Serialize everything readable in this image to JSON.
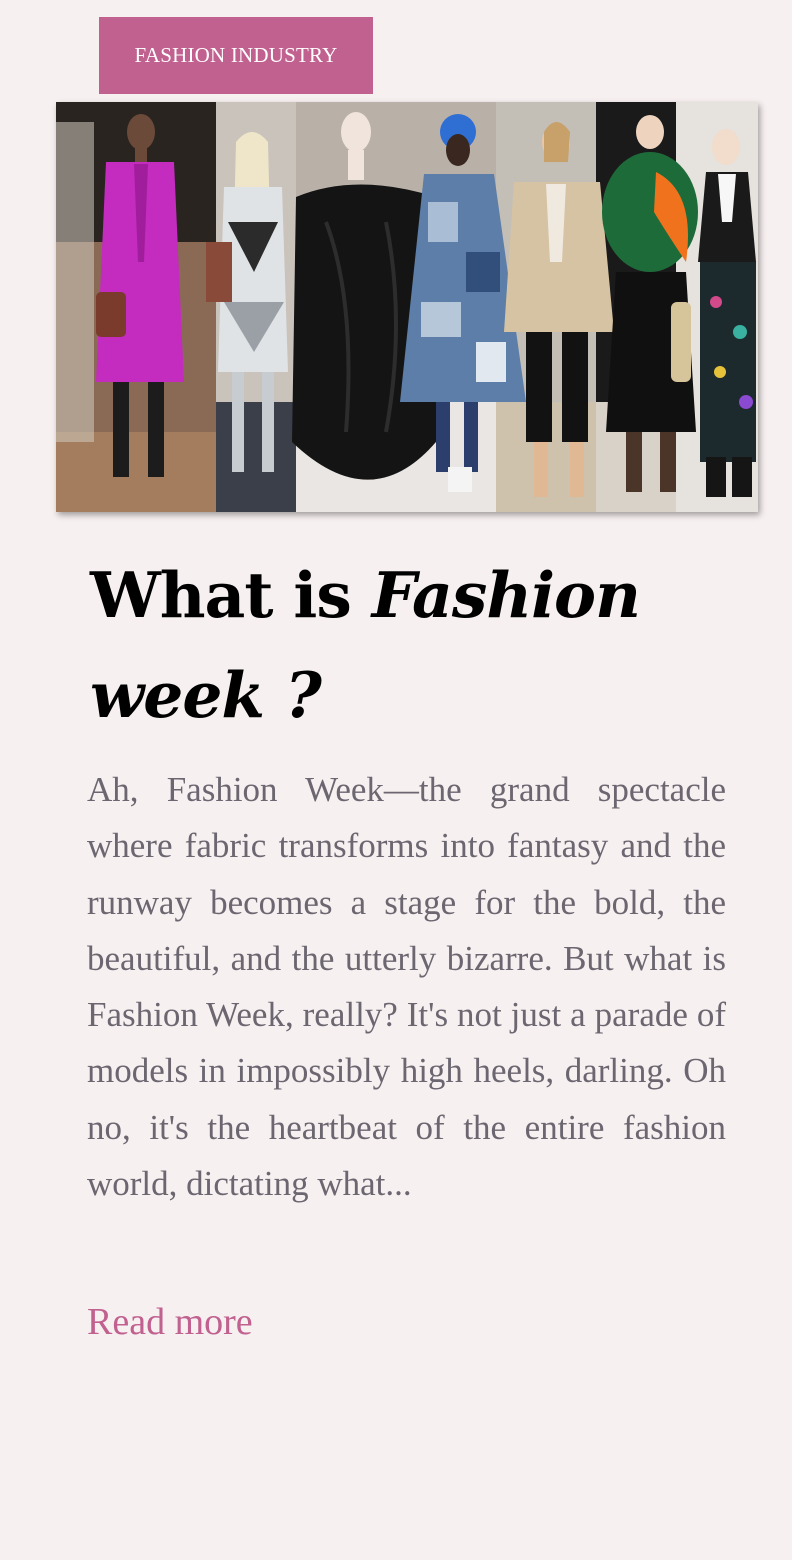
{
  "post": {
    "category": "FASHION INDUSTRY",
    "title_plain": "What is ",
    "title_italic_1": "Fashion",
    "title_italic_2": "week ?",
    "excerpt": "Ah, Fashion Week—the grand spectacle where fabric transforms into fantasy and the runway becomes a stage for the bold, the beautiful, and the utterly bizarre. But what is Fashion Week, really? It's not just a parade of models in impossibly high heels, darling. Oh no, it's the heartbeat of the entire fashion world, dictating what...",
    "read_more": "Read more"
  },
  "colors": {
    "background": "#f7f0f0",
    "accent": "#c0618f",
    "body_text": "#6b6670",
    "title_text": "#000000"
  }
}
